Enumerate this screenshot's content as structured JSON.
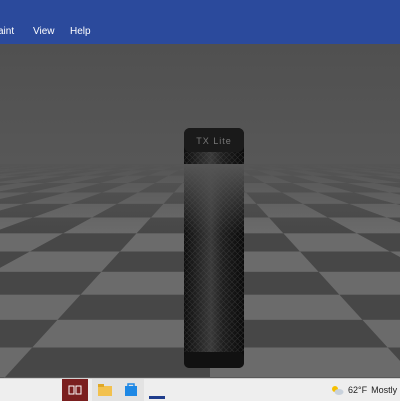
{
  "menu": {
    "items": [
      {
        "label": "aint"
      },
      {
        "label": "View"
      },
      {
        "label": "Help"
      }
    ]
  },
  "viewport": {
    "object_label": "TX Lite",
    "colors": {
      "menubar": "#2b4a9c",
      "floor_light": "#6b6b6b",
      "floor_dark": "#474747",
      "object": "#1c1c1c"
    }
  },
  "taskbar": {
    "icons": [
      "task-view-icon",
      "file-explorer-icon",
      "store-icon",
      "app-icon"
    ],
    "weather": {
      "temperature": "62°F",
      "condition": "Mostly cl"
    }
  }
}
